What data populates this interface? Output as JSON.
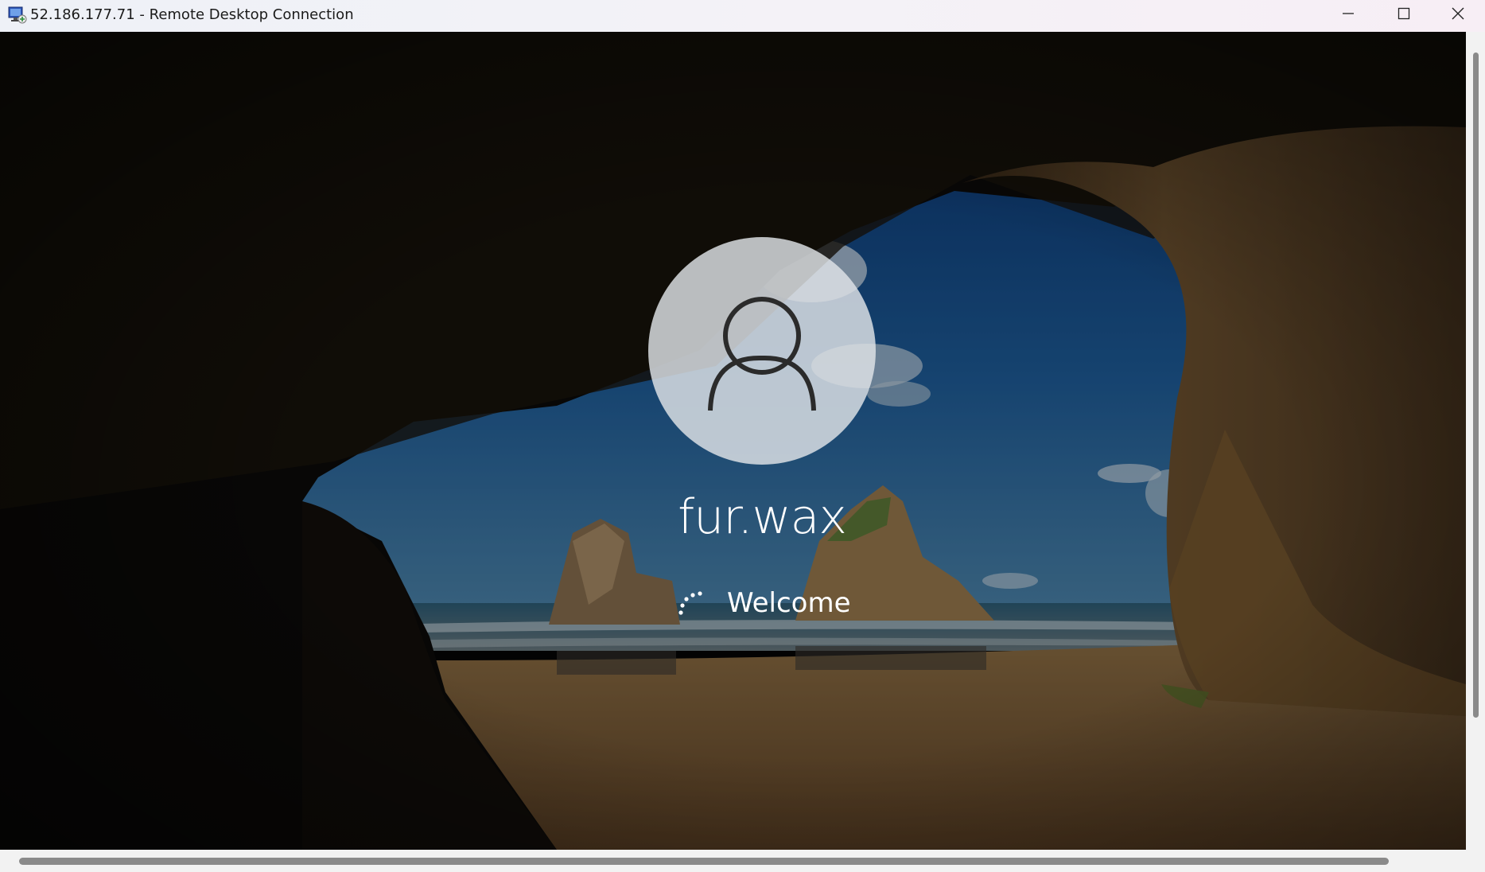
{
  "window": {
    "title": "52.186.177.71 - Remote Desktop Connection",
    "app_icon": "remote-desktop-icon",
    "controls": [
      "minimize-icon",
      "maximize-icon",
      "close-icon"
    ]
  },
  "login": {
    "username": "fur.wax",
    "status": "Welcome",
    "avatar_icon": "user-avatar-icon",
    "progress_icon": "loading-spinner-icon"
  },
  "colors": {
    "titlebar": "#eef1f7",
    "sky": "#1e5a9a",
    "sand": "#8b6a3e",
    "rock": "#6b4e2c"
  }
}
